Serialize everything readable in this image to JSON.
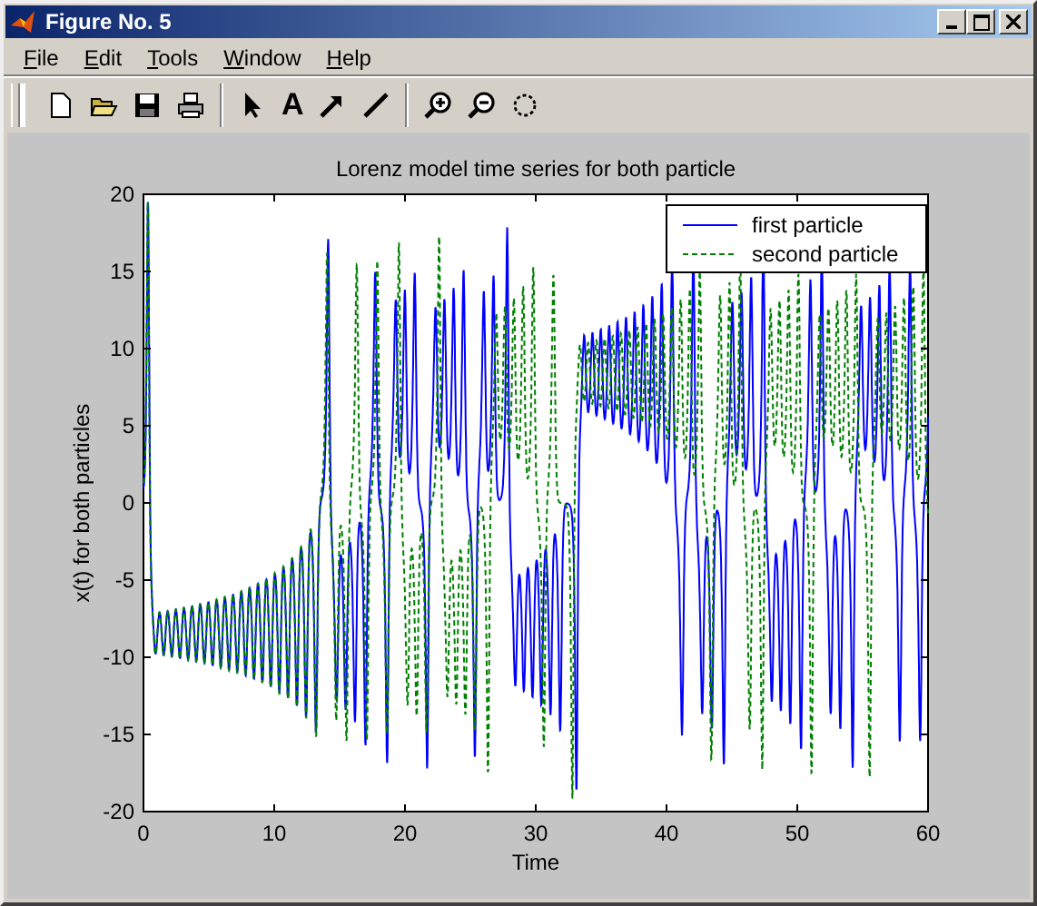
{
  "window": {
    "title": "Figure No. 5"
  },
  "toolbar_text_tool": "A",
  "menu": [
    {
      "label": "File"
    },
    {
      "label": "Edit"
    },
    {
      "label": "Tools"
    },
    {
      "label": "Window"
    },
    {
      "label": "Help"
    }
  ],
  "plot": {
    "title": "Lorenz model time series for both particle",
    "xlabel": "Time",
    "ylabel": "x(t) for both particles",
    "xticks": [
      "0",
      "10",
      "20",
      "30",
      "40",
      "50",
      "60"
    ],
    "yticks": [
      "20",
      "15",
      "10",
      "5",
      "0",
      "-5",
      "-10",
      "-15",
      "-20"
    ],
    "legend": [
      {
        "label": "first particle",
        "color": "#0000ff",
        "kind": "solid"
      },
      {
        "label": "second particle",
        "color": "#008000",
        "kind": "dashed"
      }
    ]
  }
}
